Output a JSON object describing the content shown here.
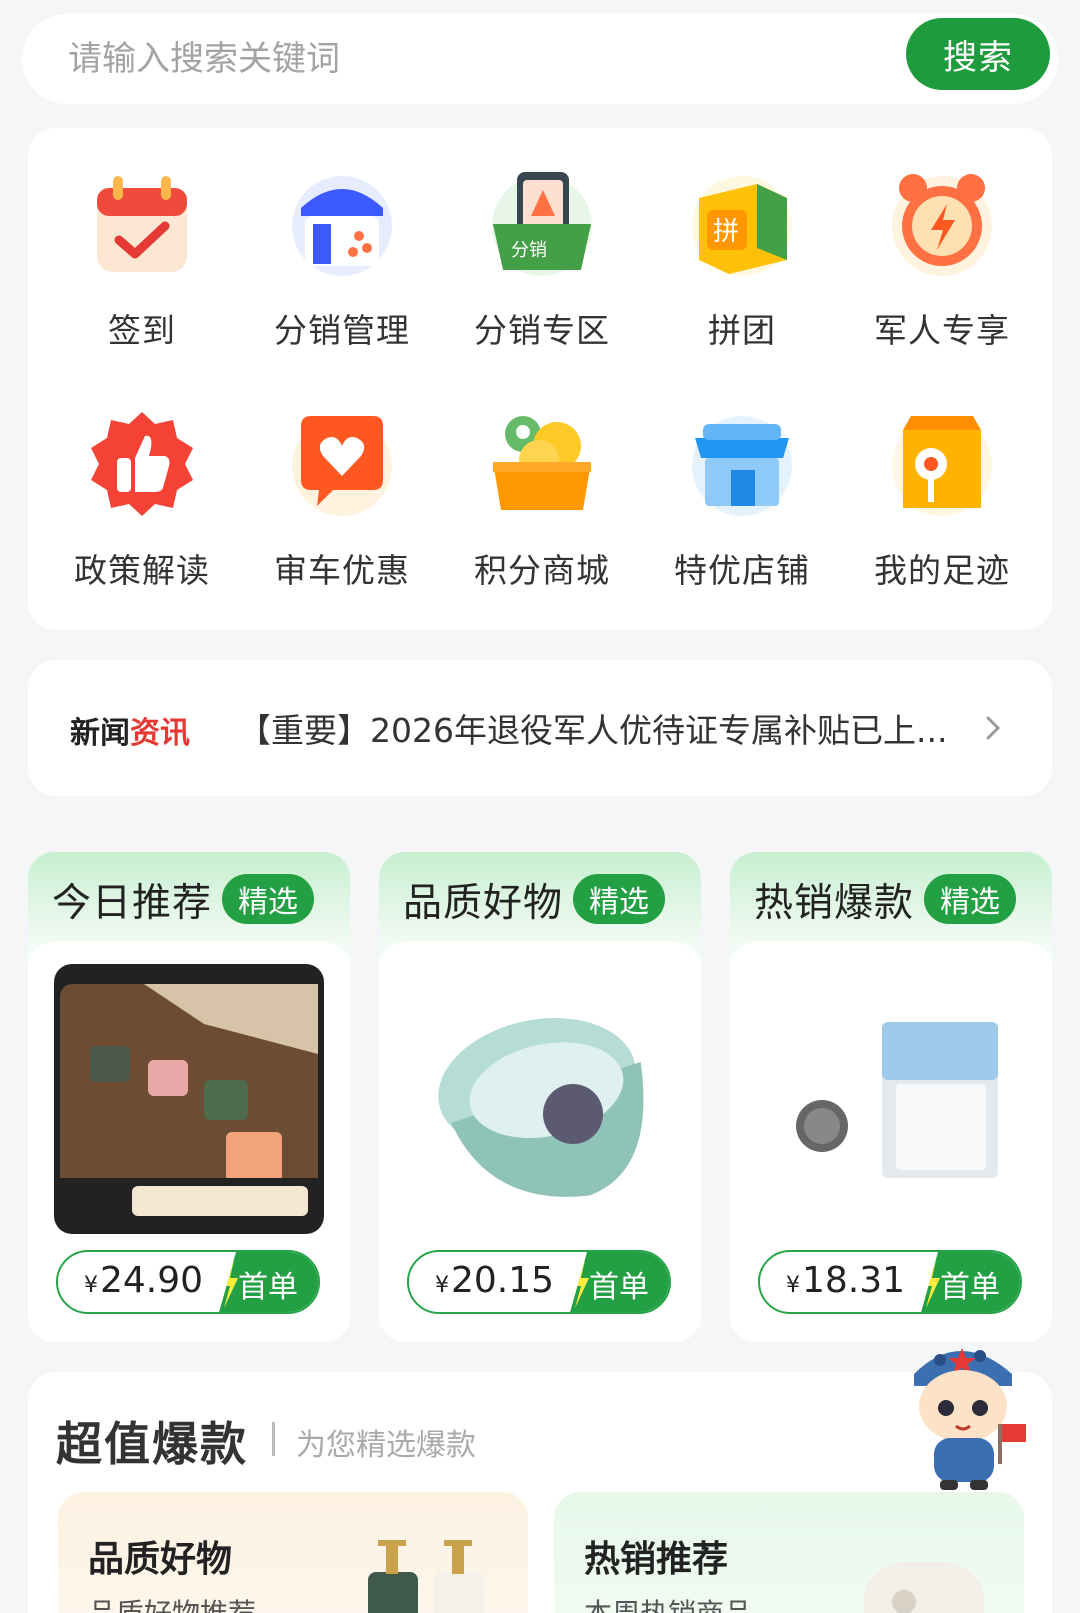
{
  "search": {
    "placeholder": "请输入搜索关键词",
    "button_label": "搜索"
  },
  "menu": [
    {
      "label": "签到",
      "icon": "calendar-check-icon"
    },
    {
      "label": "分销管理",
      "icon": "shop-share-icon"
    },
    {
      "label": "分销专区",
      "icon": "distribution-box-icon"
    },
    {
      "label": "拼团",
      "icon": "group-buy-box-icon"
    },
    {
      "label": "军人专享",
      "icon": "alarm-clock-icon"
    },
    {
      "label": "政策解读",
      "icon": "thumbs-up-icon"
    },
    {
      "label": "审车优惠",
      "icon": "heart-chat-icon"
    },
    {
      "label": "积分商城",
      "icon": "points-coins-icon"
    },
    {
      "label": "特优店铺",
      "icon": "store-icon"
    },
    {
      "label": "我的足迹",
      "icon": "footprint-location-icon"
    }
  ],
  "news": {
    "tag_part1": "新闻",
    "tag_part2": "资讯",
    "headline": "【重要】2026年退役军人优待证专属补贴已上...",
    "colors": {
      "tag_part2": "#e53935"
    }
  },
  "recommend": [
    {
      "title": "今日推荐",
      "badge": "精选",
      "currency": "¥",
      "price": "24.90",
      "tag": "首单"
    },
    {
      "title": "品质好物",
      "badge": "精选",
      "currency": "¥",
      "price": "20.15",
      "tag": "首单"
    },
    {
      "title": "热销爆款",
      "badge": "精选",
      "currency": "¥",
      "price": "18.31",
      "tag": "首单"
    }
  ],
  "super_value": {
    "title": "超值爆款",
    "subtitle": "为您精选爆款",
    "cards": [
      {
        "title": "品质好物",
        "desc": "品质好物推荐"
      },
      {
        "title": "热销推荐",
        "desc": "本周热销商品"
      }
    ]
  },
  "colors": {
    "primary_green": "#1e9b3c",
    "badge_green": "#23a043",
    "background": "#f5f6f7"
  }
}
